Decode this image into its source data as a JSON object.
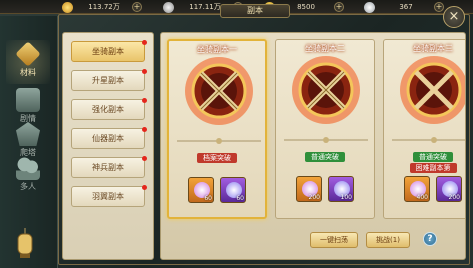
{
  "currencies": [
    {
      "icon": "gold-ingot-icon",
      "value": "113.72万",
      "color": "#e9b540"
    },
    {
      "icon": "silver-coin-icon",
      "value": "117.11万",
      "color": "#c9c9c9"
    },
    {
      "icon": "gold-coin-icon",
      "value": "8500",
      "color": "#f0c23a"
    },
    {
      "icon": "pearl-icon",
      "value": "367",
      "color": "#d8d8d8"
    }
  ],
  "plus_label": "+",
  "window": {
    "title": "副本",
    "close_label": "×"
  },
  "side_tabs": [
    {
      "icon": "material-icon",
      "label": "材料",
      "active": true
    },
    {
      "icon": "story-icon",
      "label": "剧情",
      "active": false
    },
    {
      "icon": "tower-icon",
      "label": "爬塔",
      "active": false
    },
    {
      "icon": "multiplayer-icon",
      "label": "多人",
      "active": false
    }
  ],
  "sub_menu": [
    {
      "label": "坐骑副本",
      "active": true,
      "badge": true
    },
    {
      "label": "升星副本",
      "active": false,
      "badge": true
    },
    {
      "label": "强化副本",
      "active": false,
      "badge": true
    },
    {
      "label": "仙器副本",
      "active": false,
      "badge": true
    },
    {
      "label": "神兵副本",
      "active": false,
      "badge": true
    },
    {
      "label": "羽翼副本",
      "active": false,
      "badge": true
    }
  ],
  "dungeons": [
    {
      "name": "坐骑副本一",
      "tag": "档案突破",
      "tag_color": "#c0392b",
      "items": [
        {
          "gem": "#d07fe0",
          "qty": "60"
        },
        {
          "gem": "#8a7cf0",
          "qty": "60"
        }
      ]
    },
    {
      "name": "坐骑副本二",
      "tag": "普通突破",
      "tag_color": "#2f8f3a",
      "items": [
        {
          "gem": "#d07fe0",
          "qty": "200"
        },
        {
          "gem": "#8a7cf0",
          "qty": "100"
        }
      ]
    },
    {
      "name": "坐骑副本三",
      "tag": "普通突破",
      "tag_color": "#2f8f3a",
      "tag2": "困难副本第",
      "items": [
        {
          "gem": "#d07fe0",
          "qty": "400"
        },
        {
          "gem": "#8a7cf0",
          "qty": "200"
        }
      ]
    }
  ],
  "actions": {
    "sweep_label": "一键扫荡",
    "challenge_label": "挑战(1)",
    "help_label": "?"
  }
}
